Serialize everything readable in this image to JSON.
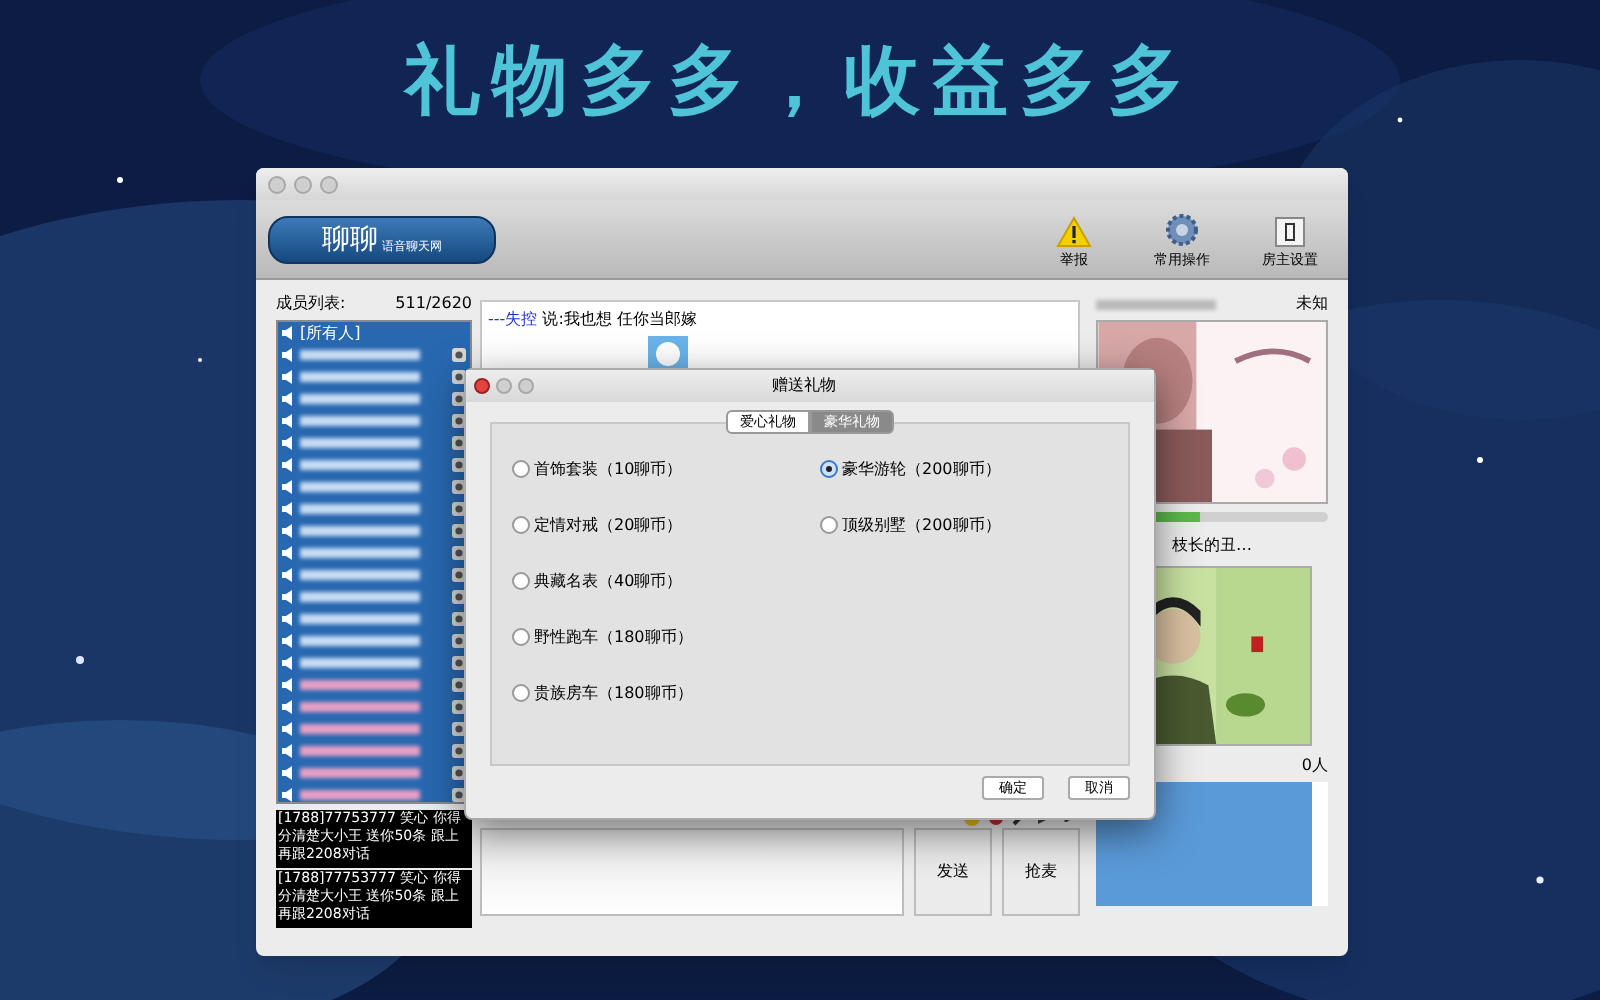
{
  "headline": "礼物多多，收益多多",
  "toolbar": {
    "logo": "聊聊",
    "logo_sub": "语音聊天网",
    "buttons": [
      {
        "kind": "warning",
        "label": "举报"
      },
      {
        "kind": "gear",
        "label": "常用操作"
      },
      {
        "kind": "door",
        "label": "房主设置"
      }
    ]
  },
  "member_list": {
    "title": "成员列表:",
    "count": "511/2620",
    "all_entry": "[所有人]"
  },
  "chat": {
    "speaker": "---失控",
    "message": "说:我也想 任你当郎嫁"
  },
  "ads": [
    "[1788]77753777 笑心 你得分清楚大小王 送你50条 跟上再跟2208对话",
    "[1788]77753777 笑心 你得分清楚大小王 送你50条 跟上再跟2208对话"
  ],
  "input_buttons": [
    "发送",
    "抢麦"
  ],
  "right_panel": {
    "status": "未知",
    "mic": {
      "level": 0.45
    },
    "second_name": "枝长的丑…",
    "audience": "0人"
  },
  "dialog": {
    "title": "赠送礼物",
    "tabs": [
      {
        "label": "爱心礼物",
        "selected": false
      },
      {
        "label": "豪华礼物",
        "selected": true
      }
    ],
    "gifts": [
      {
        "label": "首饰套装（10聊币）",
        "selected": false
      },
      {
        "label": "定情对戒（20聊币）",
        "selected": false
      },
      {
        "label": "典藏名表（40聊币）",
        "selected": false
      },
      {
        "label": "野性跑车（180聊币）",
        "selected": false
      },
      {
        "label": "贵族房车（180聊币）",
        "selected": false
      },
      {
        "label": "豪华游轮（200聊币）",
        "selected": true
      },
      {
        "label": "顶级别墅（200聊币）",
        "selected": false
      }
    ],
    "buttons": [
      "确定",
      "取消"
    ]
  }
}
